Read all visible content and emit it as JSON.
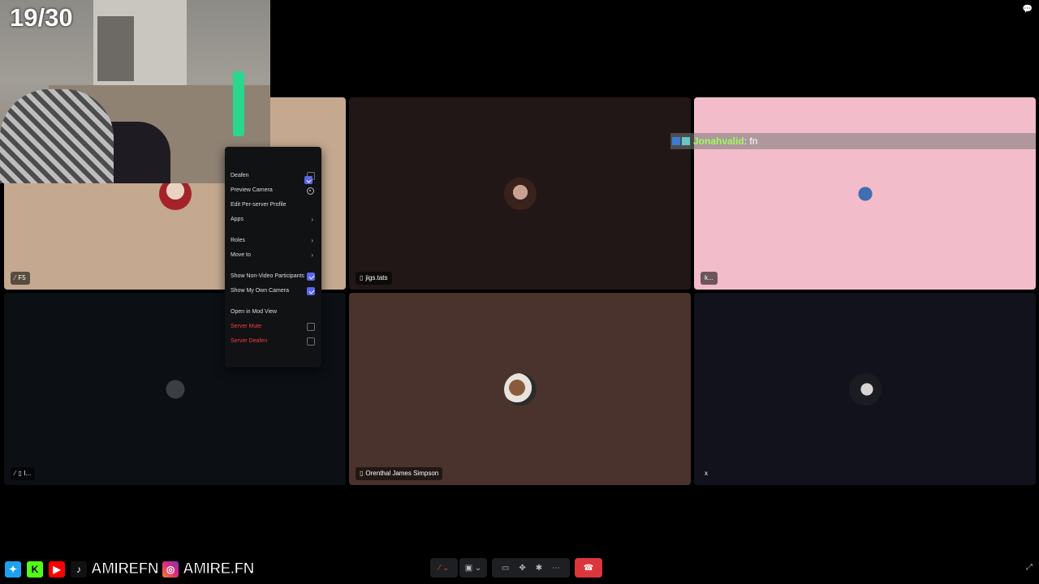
{
  "overlay": {
    "counter": "19/30",
    "chat": {
      "user": "Jonahvalid",
      "message": " : fn"
    }
  },
  "tiles": [
    {
      "name": "F5",
      "icon": "mute-mic-icon",
      "bg": "#c4a88f"
    },
    {
      "name": "jigs.tats",
      "icon": "mobile-icon",
      "bg": "#211716"
    },
    {
      "name": "k...",
      "icon": "",
      "bg": "#f3bccb"
    },
    {
      "name": "l...",
      "icon": "mute-mic-icon",
      "bg": "#0c0f14"
    },
    {
      "name": "Orenthal James Simpson",
      "icon": "mobile-icon",
      "bg": "#4a332c"
    },
    {
      "name": "x",
      "icon": "",
      "bg": "#12121c"
    }
  ],
  "context_menu": {
    "items": {
      "deafen": "Deafen",
      "preview_camera": "Preview Camera",
      "edit_profile": "Edit Per-server Profile",
      "apps": "Apps",
      "roles": "Roles",
      "move_to": "Move to",
      "show_non_video": "Show Non-Video Participants",
      "show_own_camera": "Show My Own Camera",
      "open_mod_view": "Open in Mod View",
      "server_mute": "Server Mute",
      "server_deafen": "Server Deafen"
    }
  },
  "socials": {
    "handle1": "AMIREFN",
    "handle2": "AMIRE.FN"
  },
  "colors": {
    "accent": "#5865f2",
    "danger": "#da373c"
  }
}
